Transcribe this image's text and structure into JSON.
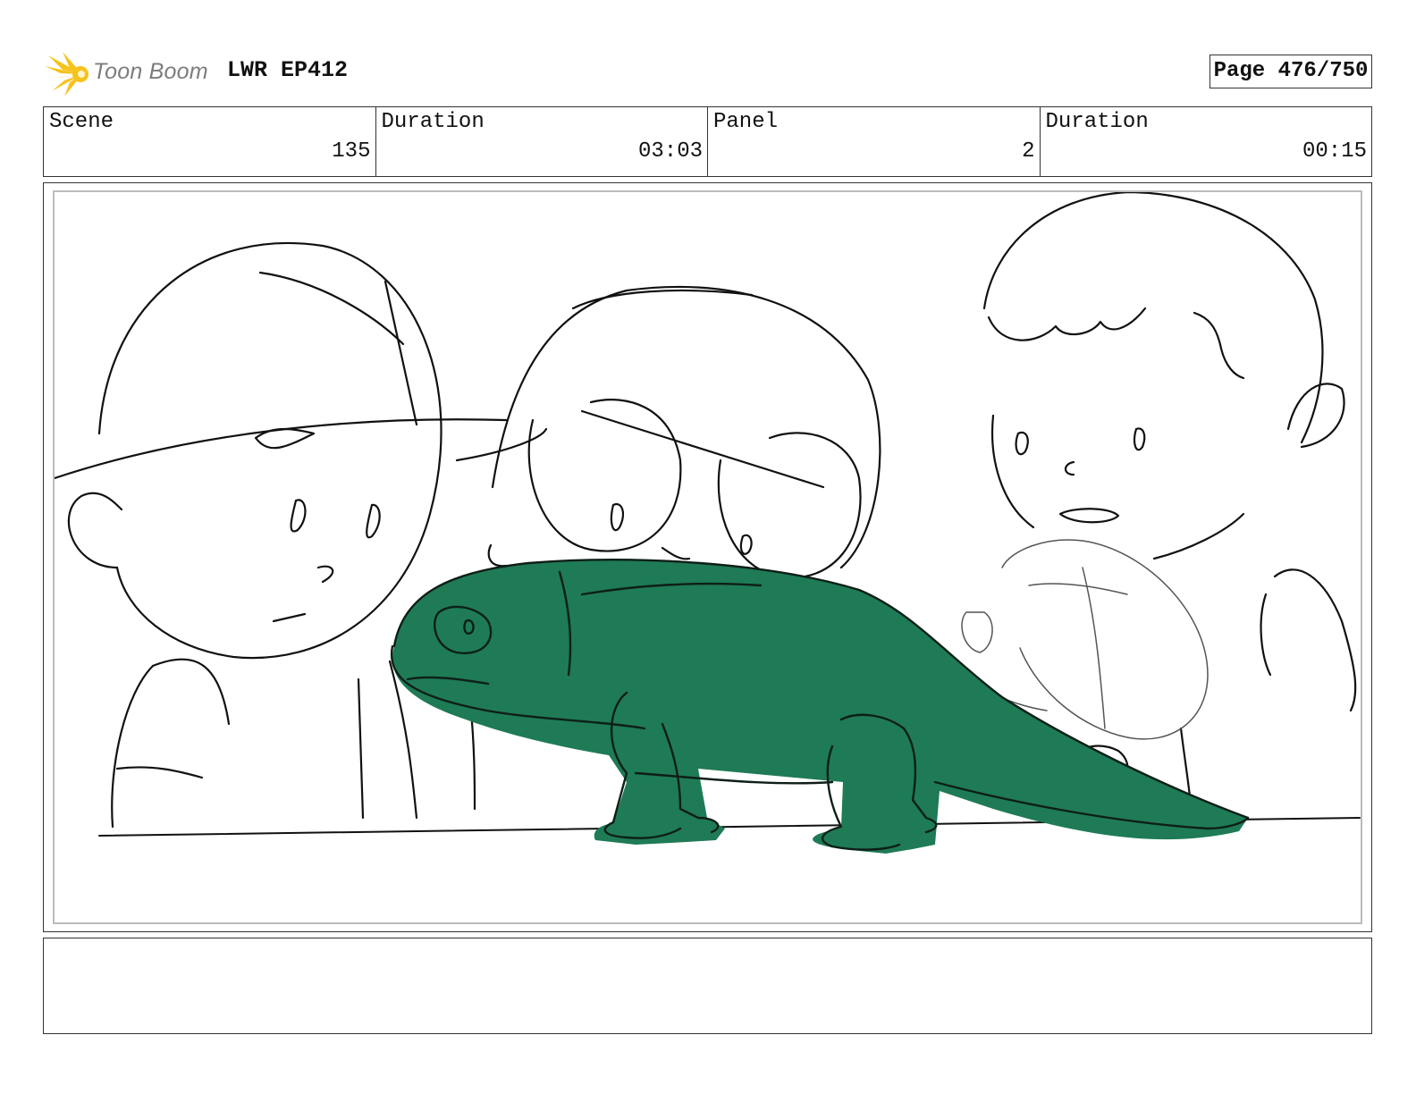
{
  "header": {
    "logo_text": "Toon Boom",
    "project_title": "LWR EP412",
    "page_label": "Page 476/750",
    "logo_color": "#F6C21C"
  },
  "info_bar": {
    "scene_label": "Scene",
    "scene_value": "135",
    "scene_duration_label": "Duration",
    "scene_duration_value": "03:03",
    "panel_label": "Panel",
    "panel_value": "2",
    "panel_duration_label": "Duration",
    "panel_duration_value": "00:15"
  },
  "panel": {
    "sketch_stroke_color": "#111111",
    "highlight_fill_color": "#1E7B56"
  },
  "notes": {
    "text": ""
  }
}
